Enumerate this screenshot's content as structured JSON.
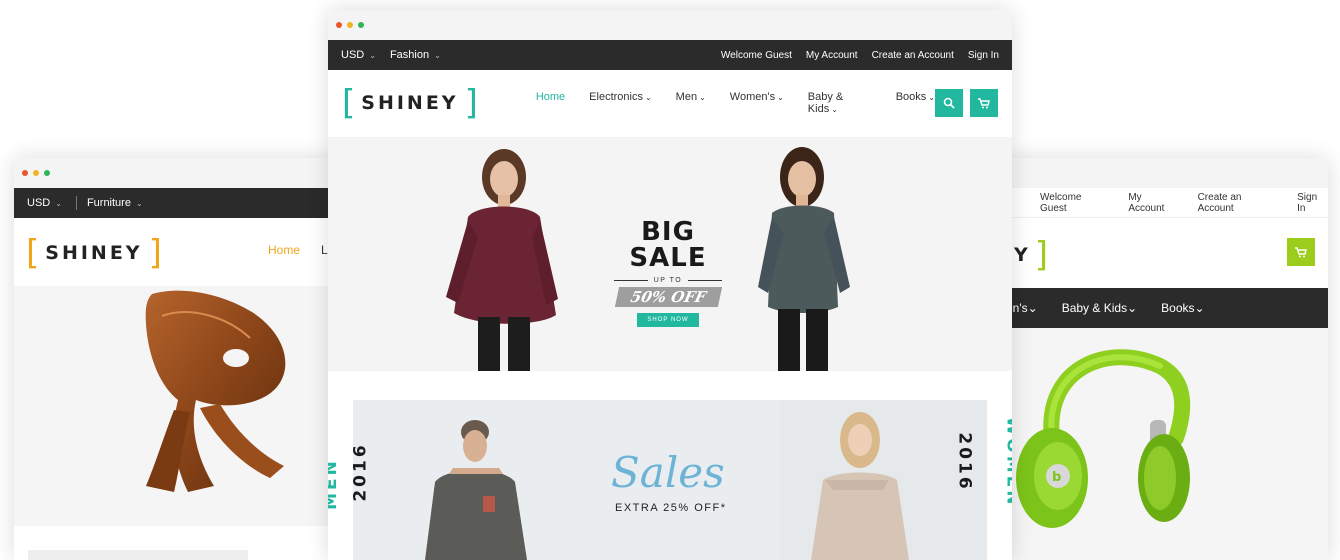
{
  "left_window": {
    "currency": "USD",
    "category": "Furniture",
    "logo": "SHINEY",
    "nav_home": "Home",
    "nav_next_initial": "L"
  },
  "right_window": {
    "top_links": [
      "Welcome Guest",
      "My Account",
      "Create an Account",
      "Sign In"
    ],
    "logo_fragment": "Y",
    "nav": [
      "...en's",
      "Baby & Kids",
      "Books"
    ]
  },
  "center_window": {
    "currency": "USD",
    "category": "Fashion",
    "top_links": [
      "Welcome Guest",
      "My Account",
      "Create an Account",
      "Sign In"
    ],
    "logo": "SHINEY",
    "nav": [
      {
        "label": "Home"
      },
      {
        "label": "Electronics"
      },
      {
        "label": "Men"
      },
      {
        "label": "Women's"
      },
      {
        "label": "Baby & Kids"
      },
      {
        "label": "Books"
      }
    ],
    "hero": {
      "headline": "BIG SALE",
      "upto": "UP TO",
      "discount": "50% OFF",
      "cta": "SHOP NOW"
    },
    "banner": {
      "men": "MEN",
      "men_year": "2016",
      "women": "WOMEN",
      "women_year": "2016",
      "sales": "Sales",
      "extra": "EXTRA 25% OFF*"
    }
  },
  "colors": {
    "center_accent": "#22b8a0",
    "left_accent": "#f0a61c",
    "right_accent": "#9ccc1c",
    "topbar": "#2b2b2b"
  }
}
